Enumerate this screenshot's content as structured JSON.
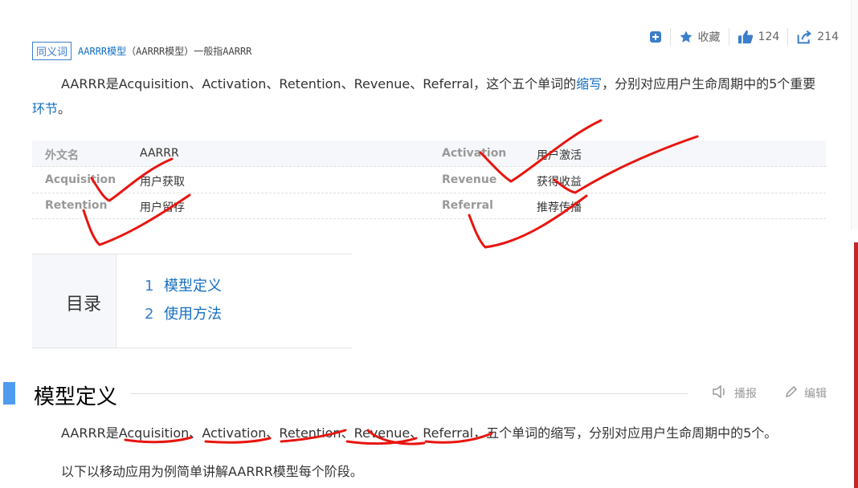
{
  "toolbar": {
    "add_icon": "plus-square-icon",
    "favorite_label": "收藏",
    "favorite_icon": "star-icon",
    "like_count": "124",
    "like_icon": "thumbs-up-icon",
    "share_count": "214",
    "share_icon": "share-icon"
  },
  "synonym": {
    "tag": "同义词",
    "link": "AARRR模型",
    "text": "（AARRR模型）一般指AARRR"
  },
  "intro": {
    "part1": "AARRR是Acquisition、Activation、Retention、Revenue、Referral，这个五个单词的",
    "link1": "缩写",
    "part2": "，分别对应用户生命周期中的5个重要",
    "link2": "环节",
    "part3": "。"
  },
  "info_table": [
    {
      "k1": "外文名",
      "v1": "AARRR",
      "k2": "Activation",
      "v2": "用户激活"
    },
    {
      "k1": "Acquisition",
      "v1": "用户获取",
      "k2": "Revenue",
      "v2": "获得收益"
    },
    {
      "k1": "Retention",
      "v1": "用户留存",
      "k2": "Referral",
      "v2": "推荐传播"
    }
  ],
  "catalog": {
    "title": "目录",
    "items": [
      {
        "num": "1",
        "label": "模型定义"
      },
      {
        "num": "2",
        "label": "使用方法"
      }
    ]
  },
  "section": {
    "title": "模型定义",
    "broadcast_label": "播报",
    "broadcast_icon": "speaker-icon",
    "edit_label": "编辑",
    "edit_icon": "pencil-icon"
  },
  "body": {
    "line1": "AARRR是Acquisition、Activation、Retention、Revenue、Referral，五个单词的缩写，分别对应用户生命周期中的5个。",
    "line2": "以下以移动应用为例简单讲解AARRR模型每个阶段。"
  },
  "colors": {
    "link": "#136ec2",
    "section_bar": "#4f9cee",
    "annotation": "#e8150f"
  }
}
